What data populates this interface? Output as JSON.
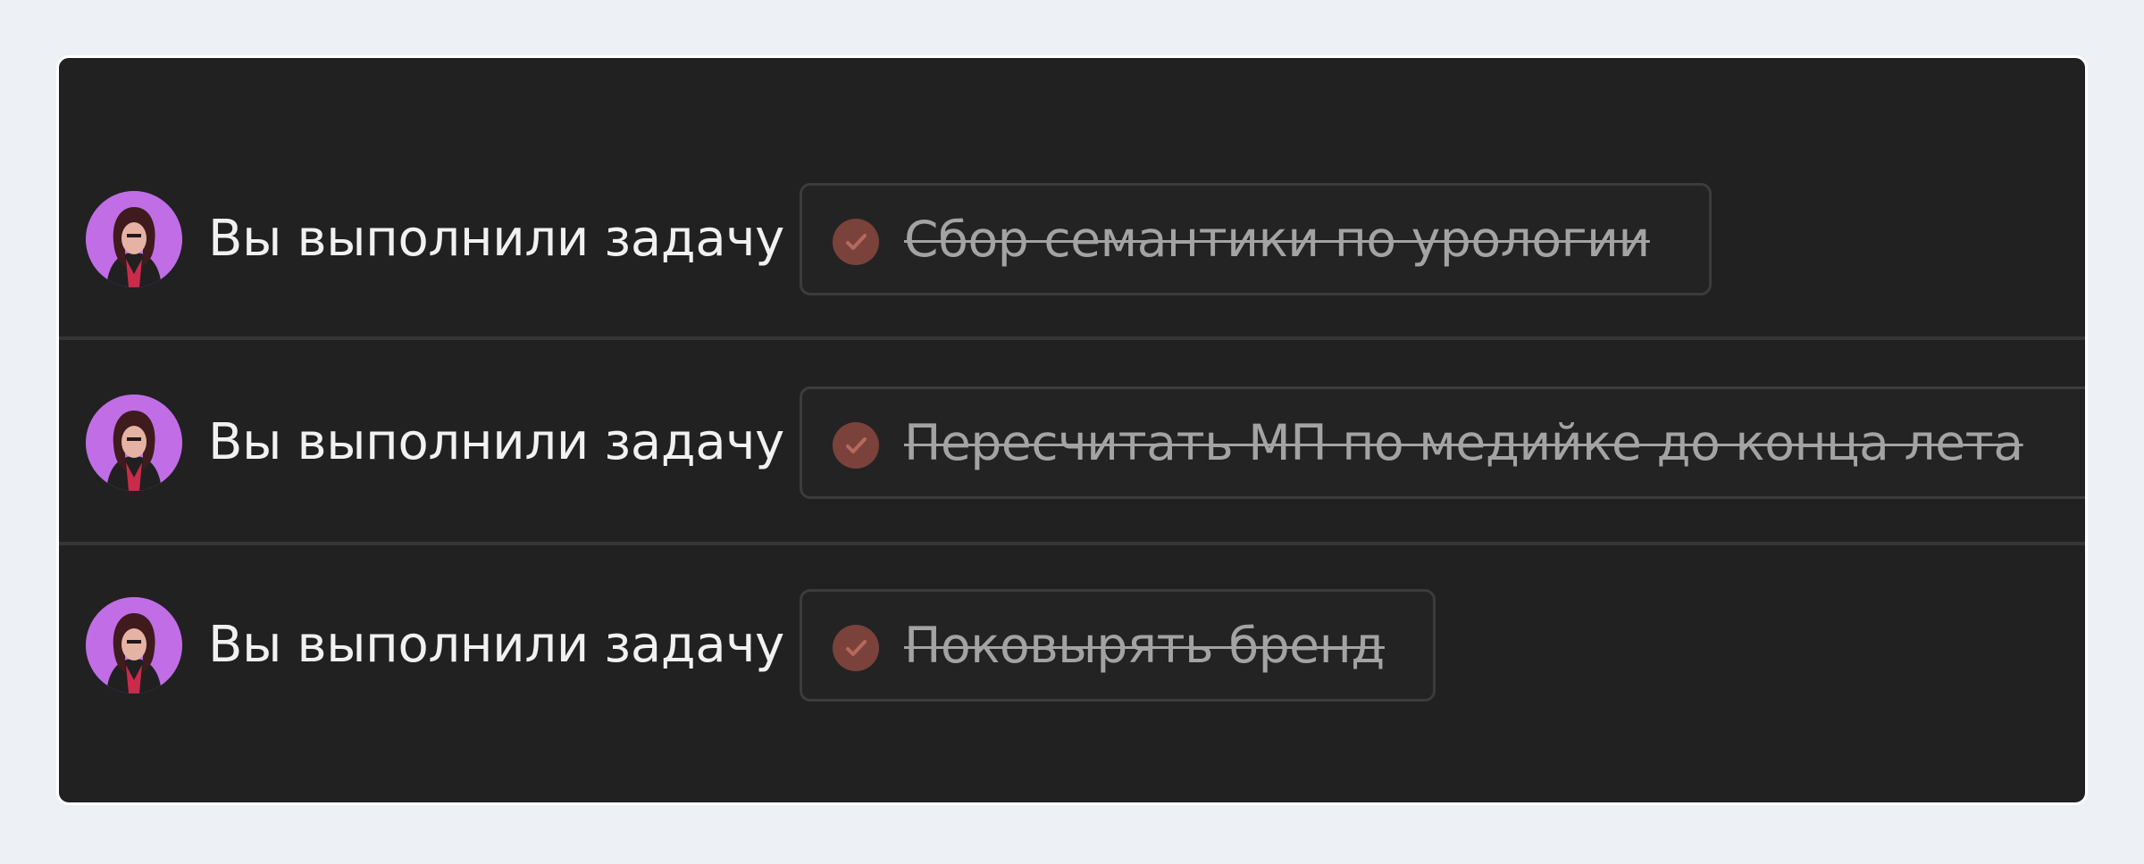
{
  "feed": {
    "items": [
      {
        "action_text": "Вы выполнили задачу",
        "task_title": "Сбор семантики по урологии"
      },
      {
        "action_text": "Вы выполнили задачу",
        "task_title": "Пересчитать МП по медийке до конца лета"
      },
      {
        "action_text": "Вы выполнили задачу",
        "task_title": "Поковырять бренд"
      }
    ]
  },
  "colors": {
    "page_background": "#edf0f5",
    "panel_background": "#212121",
    "avatar_background": "#c06de6",
    "check_icon": "#7a423a",
    "completed_text": "#a3a3a3"
  },
  "icons": {
    "avatar": "user-avatar",
    "check": "check-circle-icon"
  }
}
